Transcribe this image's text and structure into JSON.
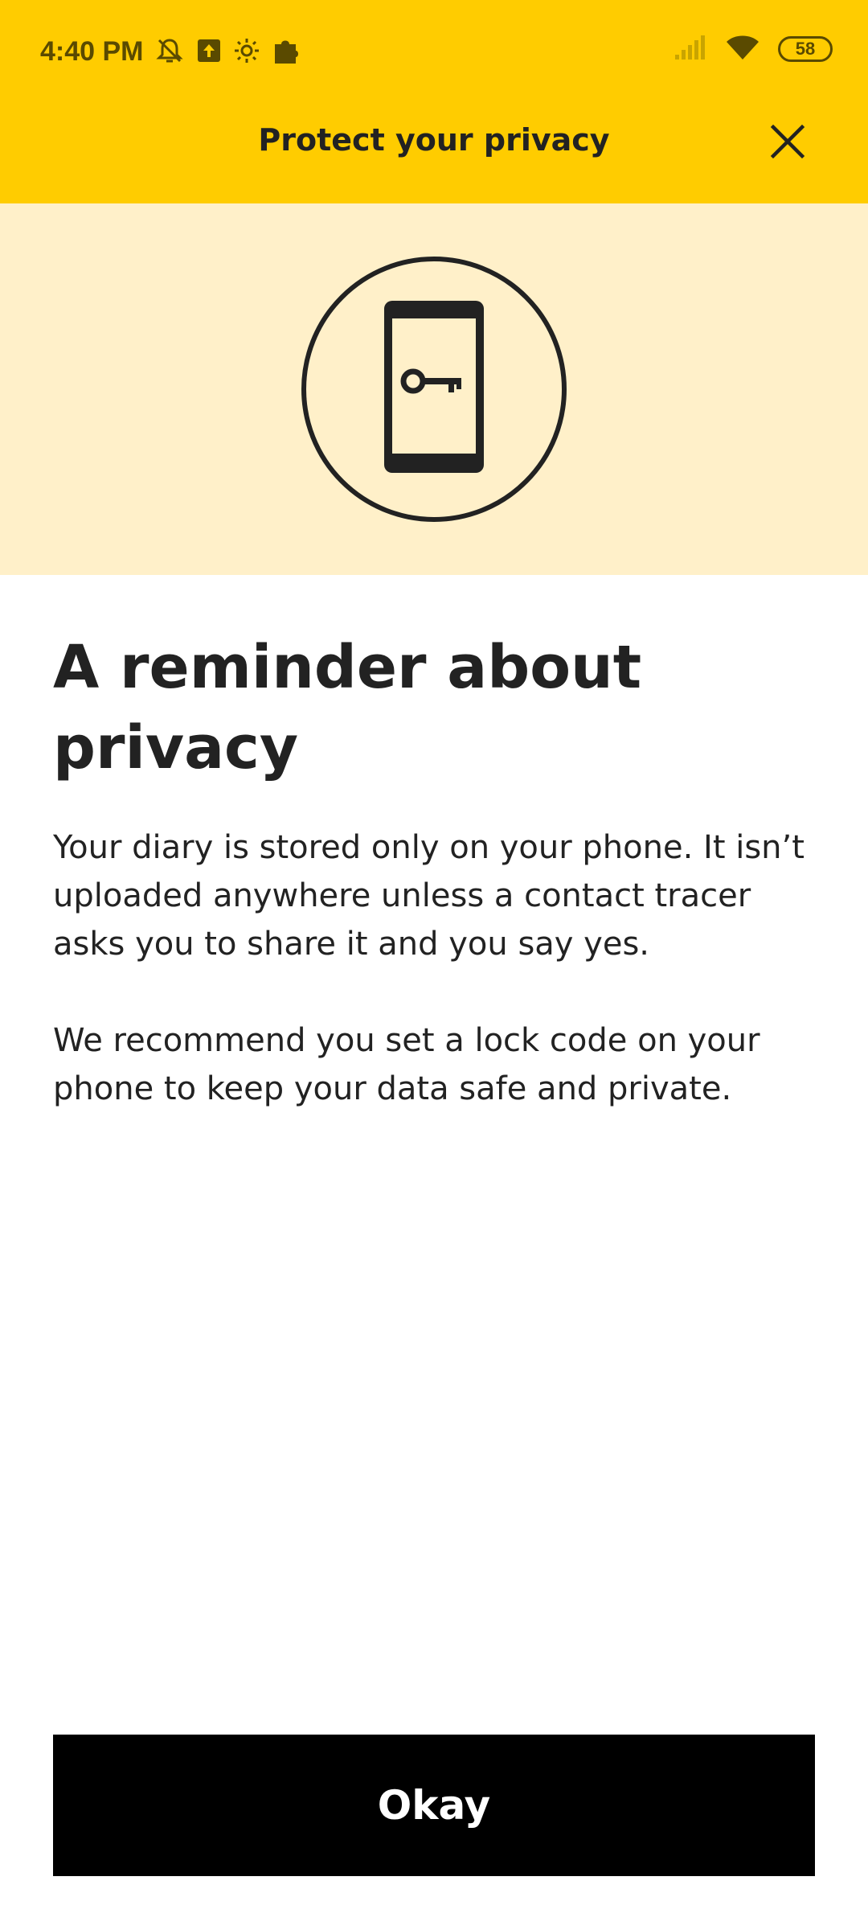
{
  "status_bar": {
    "time": "4:40 PM",
    "battery": "58",
    "left_icons": [
      "notifications-off-icon",
      "upload-icon",
      "brightness-icon",
      "puzzle-icon"
    ],
    "right_icons": [
      "signal-icon",
      "wifi-icon",
      "battery-icon"
    ]
  },
  "app_bar": {
    "title": "Protect your privacy",
    "close_icon": "close-icon"
  },
  "hero": {
    "icon": "phone-key-icon"
  },
  "content": {
    "heading": "A reminder about privacy",
    "paragraph_1": "Your diary is stored only on your phone. It isn’t uploaded anywhere unless a contact tracer asks you to share it and you say yes.",
    "paragraph_2": "We recommend you set a lock code on your phone to keep your data safe and private."
  },
  "actions": {
    "okay_label": "Okay"
  },
  "colors": {
    "header_yellow": "#FFCC00",
    "hero_background": "#FFF0C9",
    "text": "#222222",
    "button": "#000000",
    "button_text": "#FFFFFF"
  }
}
